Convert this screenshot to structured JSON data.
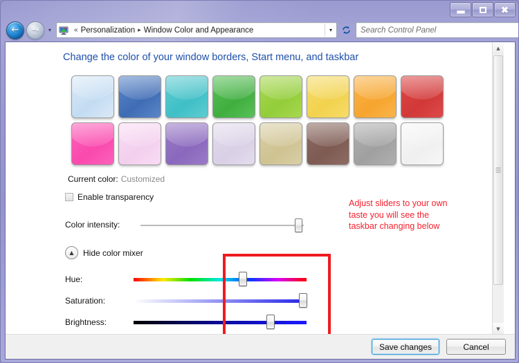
{
  "window": {
    "controls": {
      "minimize_label": "Minimize",
      "maximize_label": "Maximize",
      "close_label": "Close"
    }
  },
  "navbar": {
    "back_glyph": "←",
    "forward_glyph": "→",
    "recent_glyph": "▾",
    "breadcrumb": {
      "leading_separator": "«",
      "items": [
        "Personalization",
        "Window Color and Appearance"
      ],
      "separator": "▸"
    },
    "dropdown_glyph": "▾",
    "refresh_glyph": "↻",
    "search": {
      "placeholder": "Search Control Panel",
      "icon_glyph": "⌕"
    }
  },
  "page": {
    "title": "Change the color of your window borders, Start menu, and taskbar"
  },
  "swatches": [
    {
      "name": "sky",
      "base": "#dbe9f7",
      "edge": "#c3dcf2"
    },
    {
      "name": "blue",
      "base": "#5b86c8",
      "edge": "#3f6cb4"
    },
    {
      "name": "teal",
      "base": "#5fcdd2",
      "edge": "#3fbfc6"
    },
    {
      "name": "green",
      "base": "#59c158",
      "edge": "#3fae3f"
    },
    {
      "name": "lime",
      "base": "#a7d84f",
      "edge": "#93cd3a"
    },
    {
      "name": "yellow",
      "base": "#f6dc6a",
      "edge": "#f2d24e"
    },
    {
      "name": "orange",
      "base": "#fab44a",
      "edge": "#f6a52f"
    },
    {
      "name": "red",
      "base": "#dd4a4a",
      "edge": "#d23838"
    },
    {
      "name": "pink",
      "base": "#fc62bb",
      "edge": "#fa49ae"
    },
    {
      "name": "rose",
      "base": "#f8dcf3",
      "edge": "#f3cfee"
    },
    {
      "name": "violet",
      "base": "#9a7bc6",
      "edge": "#8a68bd"
    },
    {
      "name": "lilac",
      "base": "#e3dced",
      "edge": "#d9cfe6"
    },
    {
      "name": "khaki",
      "base": "#d9cfa6",
      "edge": "#cfc392"
    },
    {
      "name": "brown",
      "base": "#8e6b63",
      "edge": "#7d5a52"
    },
    {
      "name": "gray",
      "base": "#b0b0b0",
      "edge": "#a0a0a0"
    },
    {
      "name": "white",
      "base": "#f7f7f7",
      "edge": "#efefef"
    }
  ],
  "current_color": {
    "label": "Current color:",
    "value": "Customized"
  },
  "transparency": {
    "label": "Enable transparency",
    "checked": false
  },
  "intensity": {
    "label": "Color intensity:",
    "value_percent": 95
  },
  "mixer": {
    "toggle_label": "Hide color mixer",
    "chevron_glyph": "▲",
    "sliders": [
      {
        "name": "hue",
        "label": "Hue:",
        "value_percent": 63,
        "gradient": "linear-gradient(90deg, #ff0000 0%, #ffea00 17%, #00e000 33%, #00e8e8 50%, #0038ff 67%, #d800ff 83%, #ff0000 100%)"
      },
      {
        "name": "saturation",
        "label": "Saturation:",
        "value_percent": 98,
        "gradient": "linear-gradient(90deg, #ffffff 0%, #2323e8 100%)"
      },
      {
        "name": "brightness",
        "label": "Brightness:",
        "value_percent": 79,
        "gradient": "linear-gradient(90deg, #000000 0%, #0a0aa0 52%, #1a1aff 100%)"
      }
    ]
  },
  "annotation": {
    "text": "Adjust sliders to your own taste you will see the taskbar changing below",
    "color": "#f4212e"
  },
  "buttons": {
    "save_label": "Save changes",
    "cancel_label": "Cancel"
  },
  "scrollbar": {
    "up_glyph": "▲",
    "down_glyph": "▼"
  }
}
